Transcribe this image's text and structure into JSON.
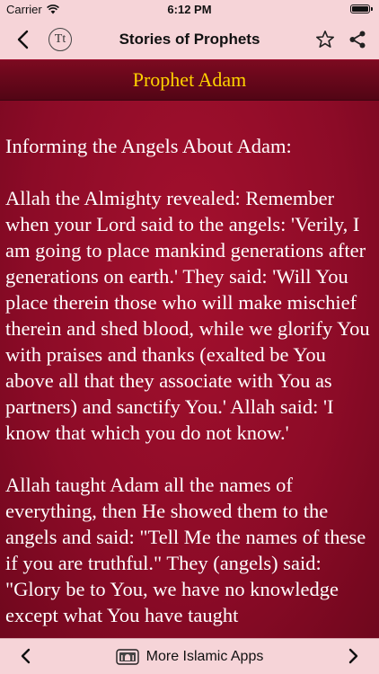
{
  "status_bar": {
    "carrier": "Carrier",
    "time": "6:12 PM",
    "battery_level": 1.0
  },
  "nav": {
    "title": "Stories of Prophets",
    "font_button_label": "Tt",
    "icons": {
      "back": "chevron-left-icon",
      "font": "text-size-icon",
      "favorite": "star-outline-icon",
      "share": "share-icon"
    }
  },
  "chapter": {
    "title": "Prophet Adam"
  },
  "story": {
    "paragraphs": [
      "Informing the Angels About Adam:",
      "Allah the Almighty revealed: Remember when your Lord said to the angels: 'Verily, I am going to place mankind generations after generations on earth.' They said: 'Will You place therein those who will make mischief therein and shed blood, while we glorify You with praises and thanks (exalted be You above all that they associate with You as partners) and sanctify You.' Allah said: 'I know that which you do not know.'",
      "Allah taught Adam all the names of everything, then He showed them to the angels and said: \"Tell Me the names of these if you are truthful.\" They (angels) said: \"Glory be to You, we have no knowledge except what You have taught"
    ]
  },
  "bottom_bar": {
    "more_apps_label": "More Islamic Apps",
    "icons": {
      "previous": "chevron-left-icon",
      "apps": "mosque-app-icon",
      "next": "chevron-right-icon"
    }
  },
  "colors": {
    "bar_background": "#f6d4d8",
    "content_background": "#8e0a26",
    "chapter_title": "#ffd200",
    "story_text": "#ffffff"
  }
}
